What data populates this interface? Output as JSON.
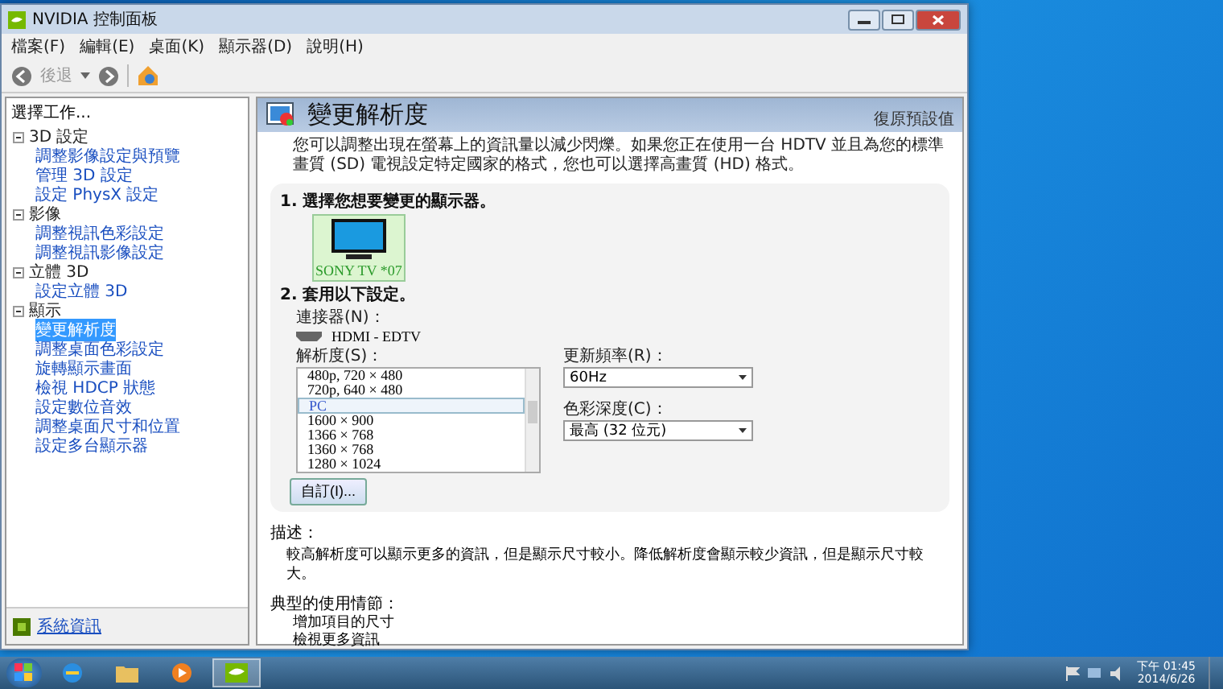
{
  "window": {
    "title": "NVIDIA 控制面板",
    "menu": [
      "檔案(F)",
      "編輯(E)",
      "桌面(K)",
      "顯示器(D)",
      "說明(H)"
    ],
    "back_label": "後退"
  },
  "sidebar": {
    "header": "選擇工作...",
    "tree": [
      {
        "label": "3D 設定",
        "expanded": true,
        "children": [
          {
            "label": "調整影像設定與預覽",
            "selected": false
          },
          {
            "label": "管理 3D 設定",
            "selected": false
          },
          {
            "label": "設定 PhysX 設定",
            "selected": false
          }
        ]
      },
      {
        "label": "影像",
        "expanded": true,
        "children": [
          {
            "label": "調整視訊色彩設定",
            "selected": false
          },
          {
            "label": "調整視訊影像設定",
            "selected": false
          }
        ]
      },
      {
        "label": "立體 3D",
        "expanded": true,
        "children": [
          {
            "label": "設定立體 3D",
            "selected": false
          }
        ]
      },
      {
        "label": "顯示",
        "expanded": true,
        "children": [
          {
            "label": "變更解析度",
            "selected": true
          },
          {
            "label": "調整桌面色彩設定",
            "selected": false
          },
          {
            "label": "旋轉顯示畫面",
            "selected": false
          },
          {
            "label": "檢視 HDCP 狀態",
            "selected": false
          },
          {
            "label": "設定數位音效",
            "selected": false
          },
          {
            "label": "調整桌面尺寸和位置",
            "selected": false
          },
          {
            "label": "設定多台顯示器",
            "selected": false
          }
        ]
      }
    ],
    "footer_link": "系統資訊"
  },
  "content": {
    "title": "變更解析度",
    "restore_link": "復原預設值",
    "intro": "您可以調整出現在螢幕上的資訊量以減少閃爍。如果您正在使用一台 HDTV 並且為您的標準畫質 (SD) 電視設定特定國家的格式，您也可以選擇高畫質 (HD) 格式。",
    "section1": {
      "heading": "1. 選擇您想要變更的顯示器。",
      "display": {
        "label": "SONY TV *07",
        "selected": true
      }
    },
    "section2": {
      "heading": "2. 套用以下設定。",
      "connector_label": "連接器(N)：",
      "connector_value": "HDMI - EDTV",
      "resolution_label": "解析度(S)：",
      "resolution_list": [
        {
          "kind": "item",
          "label": "480p, 720 × 480",
          "selected": false
        },
        {
          "kind": "item",
          "label": "720p, 640 × 480",
          "selected": false
        },
        {
          "kind": "group",
          "label": "PC",
          "selected": true
        },
        {
          "kind": "item",
          "label": "1600 × 900",
          "selected": false
        },
        {
          "kind": "item",
          "label": "1366 × 768",
          "selected": false
        },
        {
          "kind": "item",
          "label": "1360 × 768",
          "selected": false
        },
        {
          "kind": "item",
          "label": "1280 × 1024",
          "selected": false
        }
      ],
      "refresh_label": "更新頻率(R)：",
      "refresh_value": "60Hz",
      "depth_label": "色彩深度(C)：",
      "depth_value": "最高 (32 位元)",
      "custom_button": "自訂(I)..."
    },
    "description": {
      "heading": "描述：",
      "text": "較高解析度可以顯示更多的資訊，但是顯示尺寸較小。降低解析度會顯示較少資訊，但是顯示尺寸較大。"
    },
    "scenarios": {
      "heading": "典型的使用情節：",
      "items": [
        "增加項目的尺寸",
        "檢視更多資訊"
      ]
    }
  },
  "taskbar": {
    "apps": [
      {
        "kind": "ie",
        "selected": false
      },
      {
        "kind": "folder",
        "selected": false
      },
      {
        "kind": "media",
        "selected": false
      },
      {
        "kind": "nvidia",
        "selected": true
      }
    ],
    "time": "下午 01:45",
    "date": "2014/6/26"
  }
}
